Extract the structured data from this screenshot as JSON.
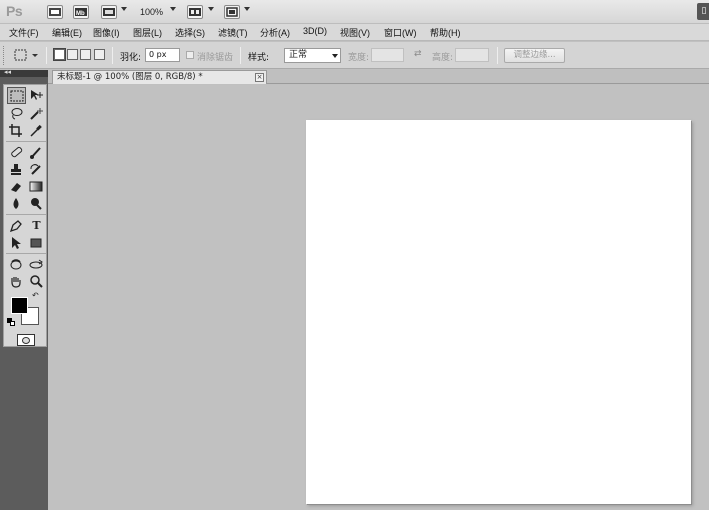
{
  "app": {
    "logo": "Ps",
    "zoom": "100%"
  },
  "appbar": {
    "buttons": [
      {
        "name": "bridge-button",
        "label": "Br"
      },
      {
        "name": "minibridge-button",
        "label": "Mb"
      },
      {
        "name": "view-extras-button",
        "label": ""
      },
      {
        "name": "arrange-docs-button",
        "label": ""
      },
      {
        "name": "screen-mode-button",
        "label": ""
      }
    ]
  },
  "menu": {
    "items": [
      "文件(F)",
      "编辑(E)",
      "图像(I)",
      "图层(L)",
      "选择(S)",
      "滤镜(T)",
      "分析(A)",
      "3D(D)",
      "视图(V)",
      "窗口(W)",
      "帮助(H)"
    ]
  },
  "options": {
    "feather_label": "羽化:",
    "feather_value": "0 px",
    "antialias_label": "消除锯齿",
    "style_label": "样式:",
    "style_value": "正常",
    "width_label": "宽度:",
    "height_label": "高度:",
    "swap_icon": "⇄",
    "refine_edge_label": "调整边缘..."
  },
  "document": {
    "tab_title": "未标题-1 @ 100% (图层 0, RGB/8) *",
    "close_glyph": "×"
  },
  "tools": {
    "type_tool_glyph": "T",
    "swap_colors_glyph": "↶"
  },
  "colors": {
    "foreground": "#000000",
    "background": "#ffffff",
    "workspace": "#c1c1c1",
    "tools_panel": "#5c5c5c"
  }
}
